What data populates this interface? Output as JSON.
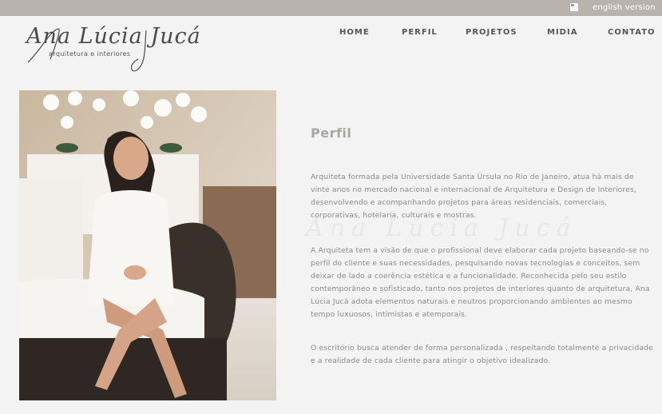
{
  "topbar": {
    "flag_icon": "uk-flag-icon",
    "lang_label": "english version"
  },
  "logo": {
    "script_text": "Ana Lúcia Jucá",
    "subtitle": "arquitetura e interiores"
  },
  "nav": {
    "items": [
      {
        "label": "HOME"
      },
      {
        "label": "PERFIL"
      },
      {
        "label": "PROJETOS"
      },
      {
        "label": "MIDIA"
      },
      {
        "label": "CONTATO"
      }
    ]
  },
  "content": {
    "title": "Perfil",
    "watermark": "Ana Lúcia Jucá",
    "paragraphs": [
      "Arquiteta formada pela Universidade Santa Úrsula no Rio de Janeiro, atua há mais de vinte anos no mercado nacional e internacional de Arquitetura e Design de Interiores, desenvolvendo e acompanhando projetos para áreas residenciais, comerciais, corporativas, hotelaria, culturais e mostras.",
      "A Arquiteta tem a visão de que o profissional deve elaborar cada projeto baseando-se no perfil do cliente e suas necessidades, pesquisando novas tecnologias e conceitos, sem deixar de lado a coerência estética e a funcionalidade. Reconhecida pelo seu estilo contemporâneo e sofisticado, tanto nos projetos de interiores quanto de arquitetura, Ana Lúcia Jucá adota elementos naturais e neutros proporcionando ambientes ao mesmo tempo luxuosos, intimistas e atemporais.",
      "O escritório busca atender de forma personalizada , respeitando totalmente a privacidade e a realidade de cada cliente para atingir o objetivo idealizado."
    ]
  },
  "colors": {
    "topbar": "#b8b4ad",
    "background": "#f3f3f3",
    "title": "#a8a7a2",
    "body_text": "#8a8a8a",
    "nav_text": "#555555"
  }
}
